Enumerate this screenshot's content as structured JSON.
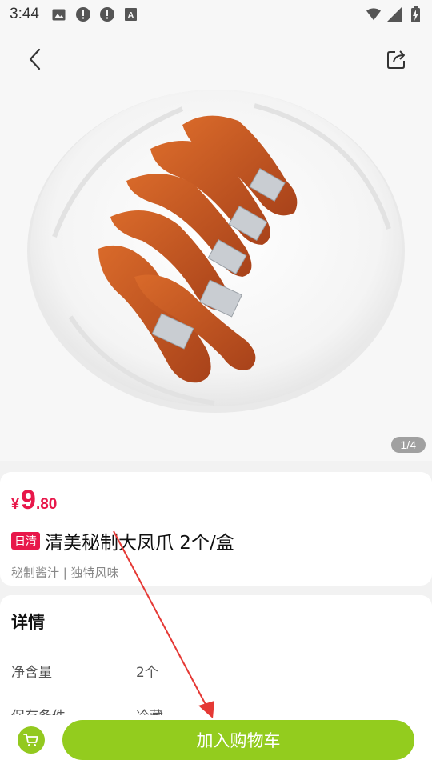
{
  "status_bar": {
    "time": "3:44",
    "left_icons": [
      "image-icon",
      "alert-icon",
      "alert-icon",
      "text-icon"
    ],
    "right_icons": [
      "wifi-icon",
      "signal-icon",
      "battery-icon"
    ]
  },
  "header": {
    "back_icon": "chevron-left-icon",
    "share_icon": "share-icon"
  },
  "gallery": {
    "page_indicator": "1/4"
  },
  "product": {
    "price_symbol": "¥",
    "price_integer": "9",
    "price_decimal": ".80",
    "tag": "日清",
    "title": "清美秘制大凤爪 2个/盒",
    "subtitle": "秘制酱汁 | 独特风味"
  },
  "details": {
    "title": "详情",
    "specs": [
      {
        "key": "净含量",
        "value": "2个"
      },
      {
        "key": "保存条件",
        "value": "冷藏"
      }
    ]
  },
  "bottom_bar": {
    "add_to_cart_label": "加入购物车",
    "cart_icon": "cart-icon"
  },
  "colors": {
    "accent_red": "#e8174a",
    "accent_green": "#93cc1e",
    "annotation_red": "#e53935"
  }
}
